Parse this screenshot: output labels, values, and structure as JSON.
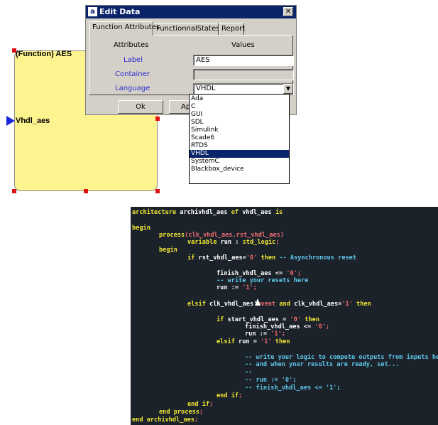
{
  "function_block": {
    "title": "(Function) AES",
    "port_label": "Vhdl_aes"
  },
  "dialog": {
    "icon_letter": "a",
    "title": "Edit Data",
    "close_glyph": "✕",
    "tabs": [
      "Function Attributes",
      "FunctionnalStates",
      "Report"
    ],
    "active_tab": 0,
    "headers": {
      "attributes": "Attributes",
      "values": "Values"
    },
    "rows": [
      {
        "label": "Label",
        "value": "AES"
      },
      {
        "label": "Container",
        "value": ""
      },
      {
        "label": "Language",
        "value": "VHDL"
      }
    ],
    "buttons": {
      "ok": "Ok",
      "apply": "Ap"
    },
    "dropdown_arrow": "▼"
  },
  "language_options": [
    "Ada",
    "C",
    "GUI",
    "SDL",
    "Simulink",
    "Scade6",
    "RTDS",
    "VHDL",
    "SystemC",
    "Blackbox_device"
  ],
  "selected_language": "VHDL",
  "code_colors": {
    "keyword": "#f0e634",
    "comment": "#5fc8ee",
    "string": "#ee6a70",
    "background": "#1b2229"
  },
  "code_lines": {
    "l1": [
      "architecture",
      " archivhdl_aes ",
      "of",
      " vhdl_aes ",
      "is"
    ],
    "l2": [
      "begin"
    ],
    "l3": [
      "process",
      "(clk_vhdl_aes,rst_vhdl_aes)"
    ],
    "l4": [
      "variable",
      " run : ",
      "std_logic",
      ";"
    ],
    "l5": [
      "begin"
    ],
    "l6": [
      "if",
      " rst_vhdl_aes=",
      "'0'",
      " then",
      " -- Asynchronous reset"
    ],
    "l7": [
      "finish_vhdl_aes <= ",
      "'0'",
      ";"
    ],
    "l8": [
      "-- write your resets here"
    ],
    "l9": [
      "run := ",
      "'1'",
      ";"
    ],
    "l10": [
      "elsif",
      " clk_vhdl_aes'",
      "event",
      " and",
      " clk_vhdl_aes=",
      "'1'",
      " then"
    ],
    "l11": [
      "if",
      " start_vhdl_aes = ",
      "'0'",
      " then"
    ],
    "l12": [
      "finish_vhdl_aes <= ",
      "'0'",
      ";"
    ],
    "l13": [
      "run := ",
      "'1'",
      ";"
    ],
    "l14": [
      "elsif",
      " run = ",
      "'1'",
      " then"
    ],
    "l15": [
      "-- write your logic to compute outputs from inputs here"
    ],
    "l16": [
      "-- and when your results are ready, set..."
    ],
    "l17": [
      "--"
    ],
    "l18": [
      "-- run := '0';"
    ],
    "l19": [
      "-- finish_vhdl_aes <= '1';"
    ],
    "l20": [
      "end if",
      ";"
    ],
    "l21": [
      "end if",
      ";"
    ],
    "l22": [
      "end process",
      ";"
    ],
    "l23": [
      "end",
      " archivhdl_aes",
      ";"
    ]
  }
}
